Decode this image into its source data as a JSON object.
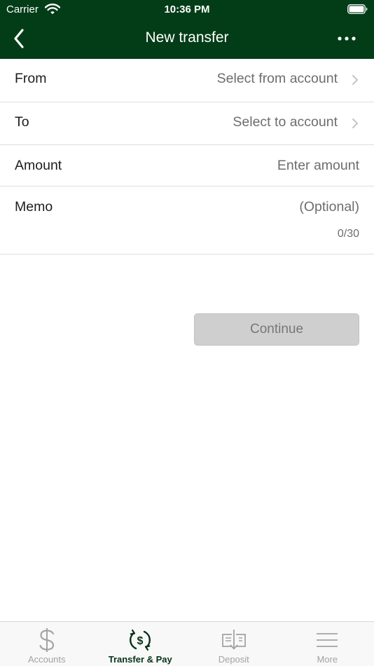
{
  "status_bar": {
    "carrier": "Carrier",
    "time": "10:36 PM"
  },
  "nav": {
    "title": "New transfer",
    "back_icon": "chevron-left-icon",
    "more_icon": "ellipsis-icon"
  },
  "form": {
    "from": {
      "label": "From",
      "value": "Select from account"
    },
    "to": {
      "label": "To",
      "value": "Select to account"
    },
    "amount": {
      "label": "Amount",
      "placeholder": "Enter amount"
    },
    "memo": {
      "label": "Memo",
      "placeholder": "(Optional)",
      "counter": "0/30"
    }
  },
  "continue_label": "Continue",
  "tabs": [
    {
      "label": "Accounts",
      "icon": "dollar-icon",
      "active": false
    },
    {
      "label": "Transfer & Pay",
      "icon": "transfer-pay-icon",
      "active": true
    },
    {
      "label": "Deposit",
      "icon": "check-deposit-icon",
      "active": false
    },
    {
      "label": "More",
      "icon": "menu-icon",
      "active": false
    }
  ],
  "colors": {
    "header_bg": "#033d18",
    "active_tab": "#05321a",
    "inactive_tab": "#a3a3a3",
    "button_disabled_bg": "#cfcfcf"
  }
}
